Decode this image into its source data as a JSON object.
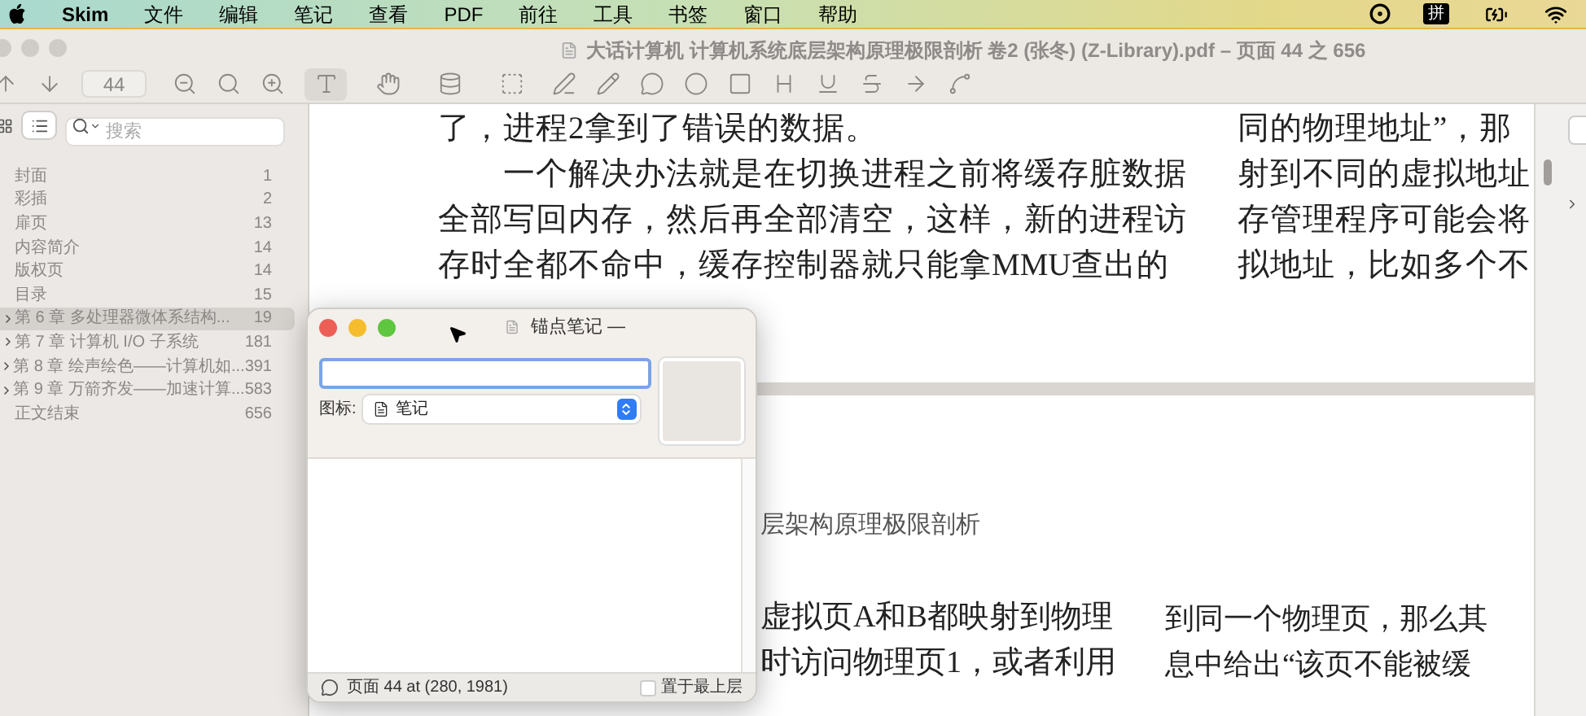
{
  "menubar": {
    "app": "Skim",
    "menus": [
      "文件",
      "编辑",
      "笔记",
      "查看",
      "PDF",
      "前往",
      "工具",
      "书签",
      "窗口",
      "帮助"
    ],
    "input_method": "拼"
  },
  "window": {
    "title": "大话计算机 计算机系统底层架构原理极限剖析 卷2 (张冬) (Z-Library).pdf – 页面 44 之 656"
  },
  "toolbar": {
    "page_field": "44",
    "tools": [
      {
        "kind": "text",
        "selected": true
      },
      {
        "kind": "hand",
        "selected": false
      },
      {
        "kind": "magnify",
        "selected": false
      },
      {
        "kind": "select",
        "selected": false
      }
    ]
  },
  "sidebar": {
    "view_buttons": [
      {
        "kind": "thumbnails",
        "selected": false
      },
      {
        "kind": "outline",
        "selected": true
      }
    ],
    "search_placeholder": "搜索",
    "items": [
      {
        "label": "封面",
        "page": "1",
        "has_children": false,
        "selected": false
      },
      {
        "label": "彩插",
        "page": "2",
        "has_children": false,
        "selected": false
      },
      {
        "label": "扉页",
        "page": "13",
        "has_children": false,
        "selected": false
      },
      {
        "label": "内容简介",
        "page": "14",
        "has_children": false,
        "selected": false
      },
      {
        "label": "版权页",
        "page": "14",
        "has_children": false,
        "selected": false
      },
      {
        "label": "目录",
        "page": "15",
        "has_children": false,
        "selected": false
      },
      {
        "label": "第 6 章  多处理器微体系结构...",
        "page": "19",
        "has_children": true,
        "selected": true
      },
      {
        "label": "第 7 章  计算机 I/O 子系统",
        "page": "181",
        "has_children": true,
        "selected": false
      },
      {
        "label": "第 8 章  绘声绘色——计算机如...",
        "page": "391",
        "has_children": true,
        "selected": false
      },
      {
        "label": "第 9 章  万箭齐发——加速计算...",
        "page": "583",
        "has_children": true,
        "selected": false
      },
      {
        "label": "正文结束",
        "page": "656",
        "has_children": false,
        "selected": false
      }
    ]
  },
  "page_1": {
    "left_column": [
      {
        "text": "了，进程2拿到了错误的数据。",
        "indent": false
      },
      {
        "text": "一个解决办法就是在切换进程之前将缓存脏数据",
        "indent": true
      },
      {
        "text": "全部写回内存，然后再全部清空，这样，新的进程访",
        "indent": false
      },
      {
        "text": "存时全都不命中，缓存控制器就只能拿MMU查出的",
        "indent": false
      }
    ],
    "right_column": [
      "同的物理地址”，那",
      "射到不同的虚拟地址",
      "存管理程序可能会将",
      "拟地址，比如多个不"
    ]
  },
  "page_2": {
    "header": "层架构原理极限剖析",
    "left_column": [
      "虚拟页A和B都映射到物理",
      "时访问物理页1，或者利用"
    ],
    "right_column": [
      "到同一个物理页，那么其",
      "息中给出“该页不能被缓"
    ]
  },
  "note_window": {
    "title": "锚点笔记 —",
    "icon_label": "图标:",
    "icon_value": "笔记",
    "location": "页面 44  at (280, 1981)",
    "keep_on_top": {
      "label": "置于最上层",
      "checked": false
    }
  }
}
